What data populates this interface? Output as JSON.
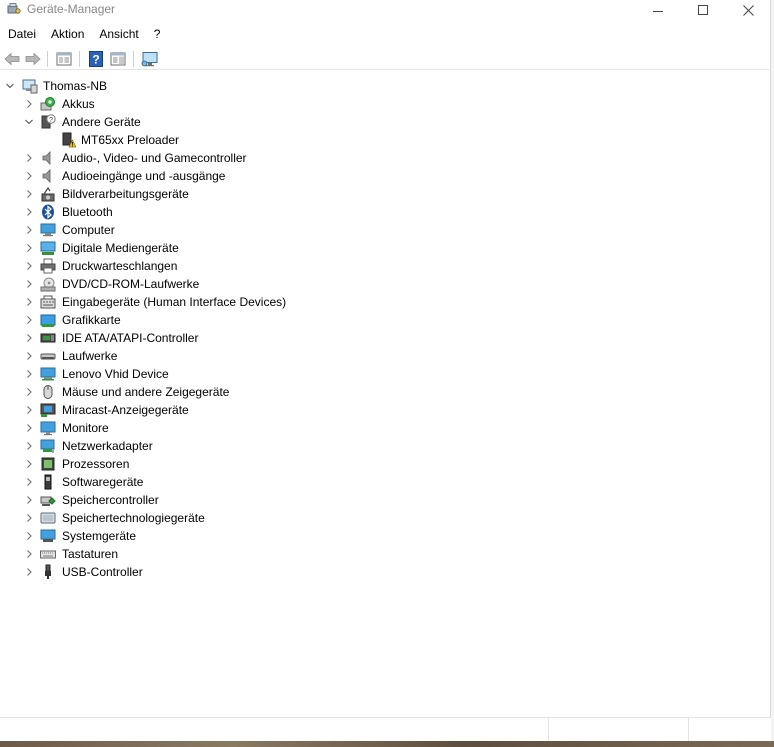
{
  "window": {
    "title": "Geräte-Manager"
  },
  "menu": [
    {
      "label": "Datei"
    },
    {
      "label": "Aktion"
    },
    {
      "label": "Ansicht"
    },
    {
      "label": "?"
    }
  ],
  "toolbar": {
    "buttons": [
      "back-arrow-icon",
      "forward-arrow-icon",
      "properties-panel-icon",
      "help-icon",
      "action-panel-icon",
      "monitor-scan-icon"
    ]
  },
  "tree": {
    "root": {
      "label": "Thomas-NB",
      "expanded": true
    },
    "categories": [
      {
        "label": "Akkus",
        "icon": "battery-icon",
        "expanded": false
      },
      {
        "label": "Andere Geräte",
        "icon": "unknown-device-icon",
        "expanded": true,
        "children": [
          {
            "label": "MT65xx Preloader",
            "icon": "warning-device-icon"
          }
        ]
      },
      {
        "label": "Audio-, Video- und Gamecontroller",
        "icon": "speaker-icon",
        "expanded": false
      },
      {
        "label": "Audioeingänge und -ausgänge",
        "icon": "speaker-icon",
        "expanded": false
      },
      {
        "label": "Bildverarbeitungsgeräte",
        "icon": "camera-icon",
        "expanded": false
      },
      {
        "label": "Bluetooth",
        "icon": "bluetooth-icon",
        "expanded": false
      },
      {
        "label": "Computer",
        "icon": "computer-icon",
        "expanded": false
      },
      {
        "label": "Digitale Mediengeräte",
        "icon": "media-device-icon",
        "expanded": false
      },
      {
        "label": "Druckwarteschlangen",
        "icon": "printer-icon",
        "expanded": false
      },
      {
        "label": "DVD/CD-ROM-Laufwerke",
        "icon": "disc-icon",
        "expanded": false
      },
      {
        "label": "Eingabegeräte (Human Interface Devices)",
        "icon": "hid-icon",
        "expanded": false
      },
      {
        "label": "Grafikkarte",
        "icon": "display-adapter-icon",
        "expanded": false
      },
      {
        "label": "IDE ATA/ATAPI-Controller",
        "icon": "ide-controller-icon",
        "expanded": false
      },
      {
        "label": "Laufwerke",
        "icon": "drive-icon",
        "expanded": false
      },
      {
        "label": "Lenovo Vhid Device",
        "icon": "lenovo-device-icon",
        "expanded": false
      },
      {
        "label": "Mäuse und andere Zeigegeräte",
        "icon": "mouse-icon",
        "expanded": false
      },
      {
        "label": "Miracast-Anzeigegeräte",
        "icon": "miracast-icon",
        "expanded": false
      },
      {
        "label": "Monitore",
        "icon": "monitor-icon",
        "expanded": false
      },
      {
        "label": "Netzwerkadapter",
        "icon": "network-adapter-icon",
        "expanded": false
      },
      {
        "label": "Prozessoren",
        "icon": "processor-icon",
        "expanded": false
      },
      {
        "label": "Softwaregeräte",
        "icon": "software-device-icon",
        "expanded": false
      },
      {
        "label": "Speichercontroller",
        "icon": "storage-controller-icon",
        "expanded": false
      },
      {
        "label": "Speichertechnologiegeräte",
        "icon": "memory-tech-icon",
        "expanded": false
      },
      {
        "label": "Systemgeräte",
        "icon": "system-device-icon",
        "expanded": false
      },
      {
        "label": "Tastaturen",
        "icon": "keyboard-icon",
        "expanded": false
      },
      {
        "label": "USB-Controller",
        "icon": "usb-icon",
        "expanded": false
      }
    ]
  },
  "colors": {
    "chevron": "#707070",
    "text": "#000000",
    "title_text": "#888888"
  }
}
